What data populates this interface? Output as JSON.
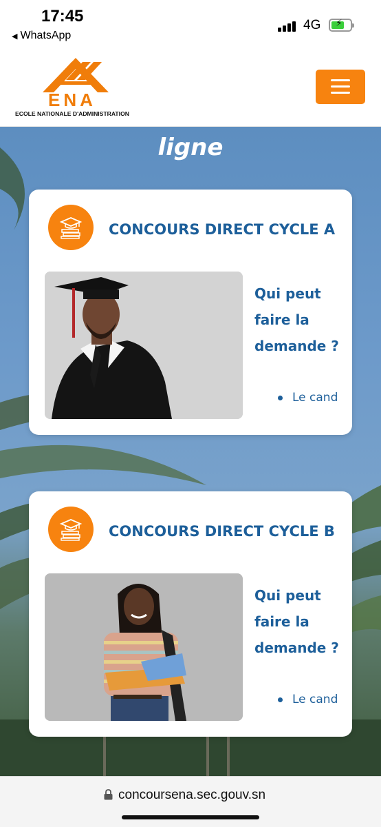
{
  "status_bar": {
    "time": "17:45",
    "back_label": "WhatsApp",
    "network": "4G",
    "battery_state": "charging"
  },
  "header": {
    "logo_text": "ENA",
    "logo_subtitle": "ECOLE NATIONALE D'ADMINISTRATION",
    "menu_icon": "hamburger-icon",
    "accent_color": "#f7830f"
  },
  "hero": {
    "title": "ligne"
  },
  "cards": [
    {
      "icon": "graduation-cap-books-icon",
      "title": "CONCOURS DIRECT CYCLE A",
      "photo": "graduate-man-photo",
      "question": "Qui peut faire la demande ?",
      "list_item": "Le cand"
    },
    {
      "icon": "graduation-cap-books-icon",
      "title": "CONCOURS DIRECT CYCLE B",
      "photo": "student-woman-photo",
      "question": "Qui peut faire la demande ?",
      "list_item": "Le cand"
    }
  ],
  "browser": {
    "url": "concoursena.sec.gouv.sn",
    "lock_icon": "lock-icon"
  },
  "colors": {
    "title_blue": "#1d5f9a",
    "orange": "#f7830f"
  }
}
